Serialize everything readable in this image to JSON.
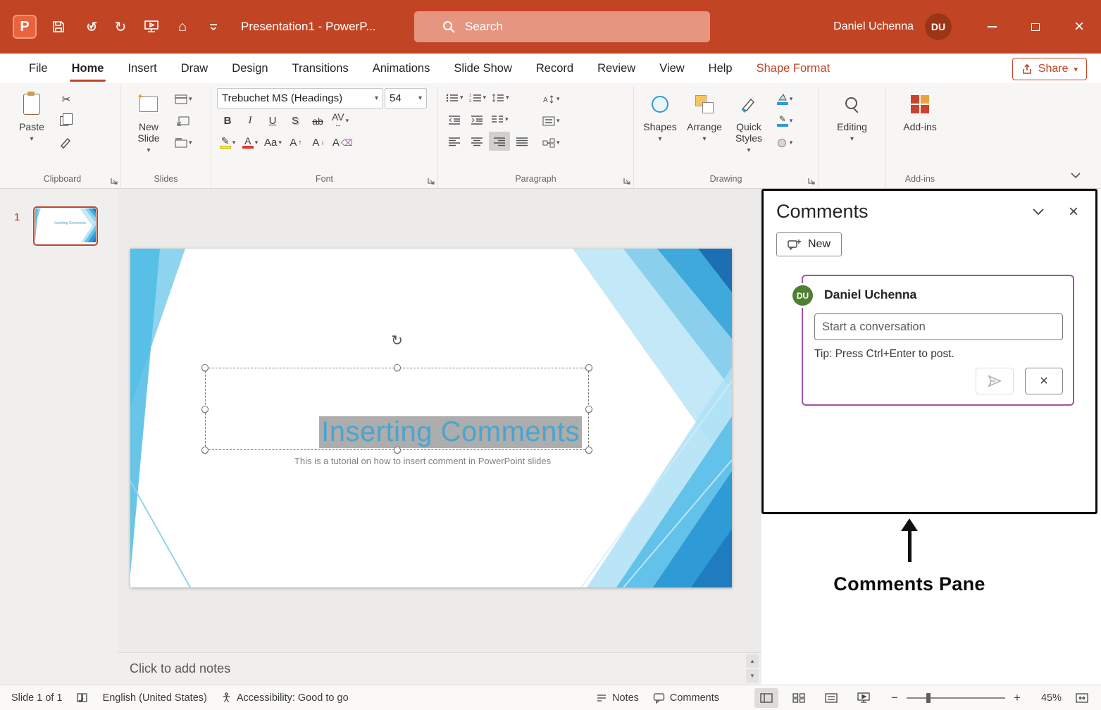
{
  "colors": {
    "titlebar_bg": "#C14524",
    "accent_red": "#C24424",
    "comment_border": "#A352A8",
    "avatar_green": "#507E32",
    "slide_title_blue": "#4AA5CF"
  },
  "titlebar": {
    "title": "Presentation1  -  PowerP...",
    "search_placeholder": "Search",
    "user_name": "Daniel Uchenna",
    "user_initials": "DU"
  },
  "menubar": {
    "tabs": [
      "File",
      "Home",
      "Insert",
      "Draw",
      "Design",
      "Transitions",
      "Animations",
      "Slide Show",
      "Record",
      "Review",
      "View",
      "Help",
      "Shape Format"
    ],
    "share": "Share"
  },
  "ribbon": {
    "paste": "Paste",
    "new_slide": "New Slide",
    "font_name": "Trebuchet MS (Headings)",
    "font_size": "54",
    "shapes": "Shapes",
    "arrange": "Arrange",
    "quick_styles": "Quick Styles",
    "editing": "Editing",
    "addins": "Add-ins",
    "glyphs": {
      "bold": "B",
      "italic": "I",
      "underline": "U",
      "shadow": "S",
      "strikethrough": "ab",
      "char_spacing": "AV",
      "font_color": "A",
      "change_case": "Aa",
      "grow_font": "A",
      "shrink_font": "A",
      "clear_format": "A"
    },
    "groups": {
      "clipboard": "Clipboard",
      "slides": "Slides",
      "font": "Font",
      "paragraph": "Paragraph",
      "drawing": "Drawing",
      "addins": "Add-ins"
    }
  },
  "thumbnails": {
    "slide_number": "1"
  },
  "slide": {
    "title": "Inserting Comments",
    "subtitle": "This is a tutorial on how to insert comment in PowerPoint slides"
  },
  "comments": {
    "pane_title": "Comments",
    "new_button": "New",
    "author": "Daniel Uchenna",
    "author_initials": "DU",
    "input_placeholder": "Start a conversation",
    "tip": "Tip: Press Ctrl+Enter to post."
  },
  "annotation": {
    "label": "Comments Pane"
  },
  "notes": {
    "placeholder": "Click to add notes"
  },
  "statusbar": {
    "slide_info": "Slide 1 of 1",
    "language": "English (United States)",
    "accessibility": "Accessibility: Good to go",
    "notes": "Notes",
    "comments": "Comments",
    "zoom_level": "45%"
  }
}
